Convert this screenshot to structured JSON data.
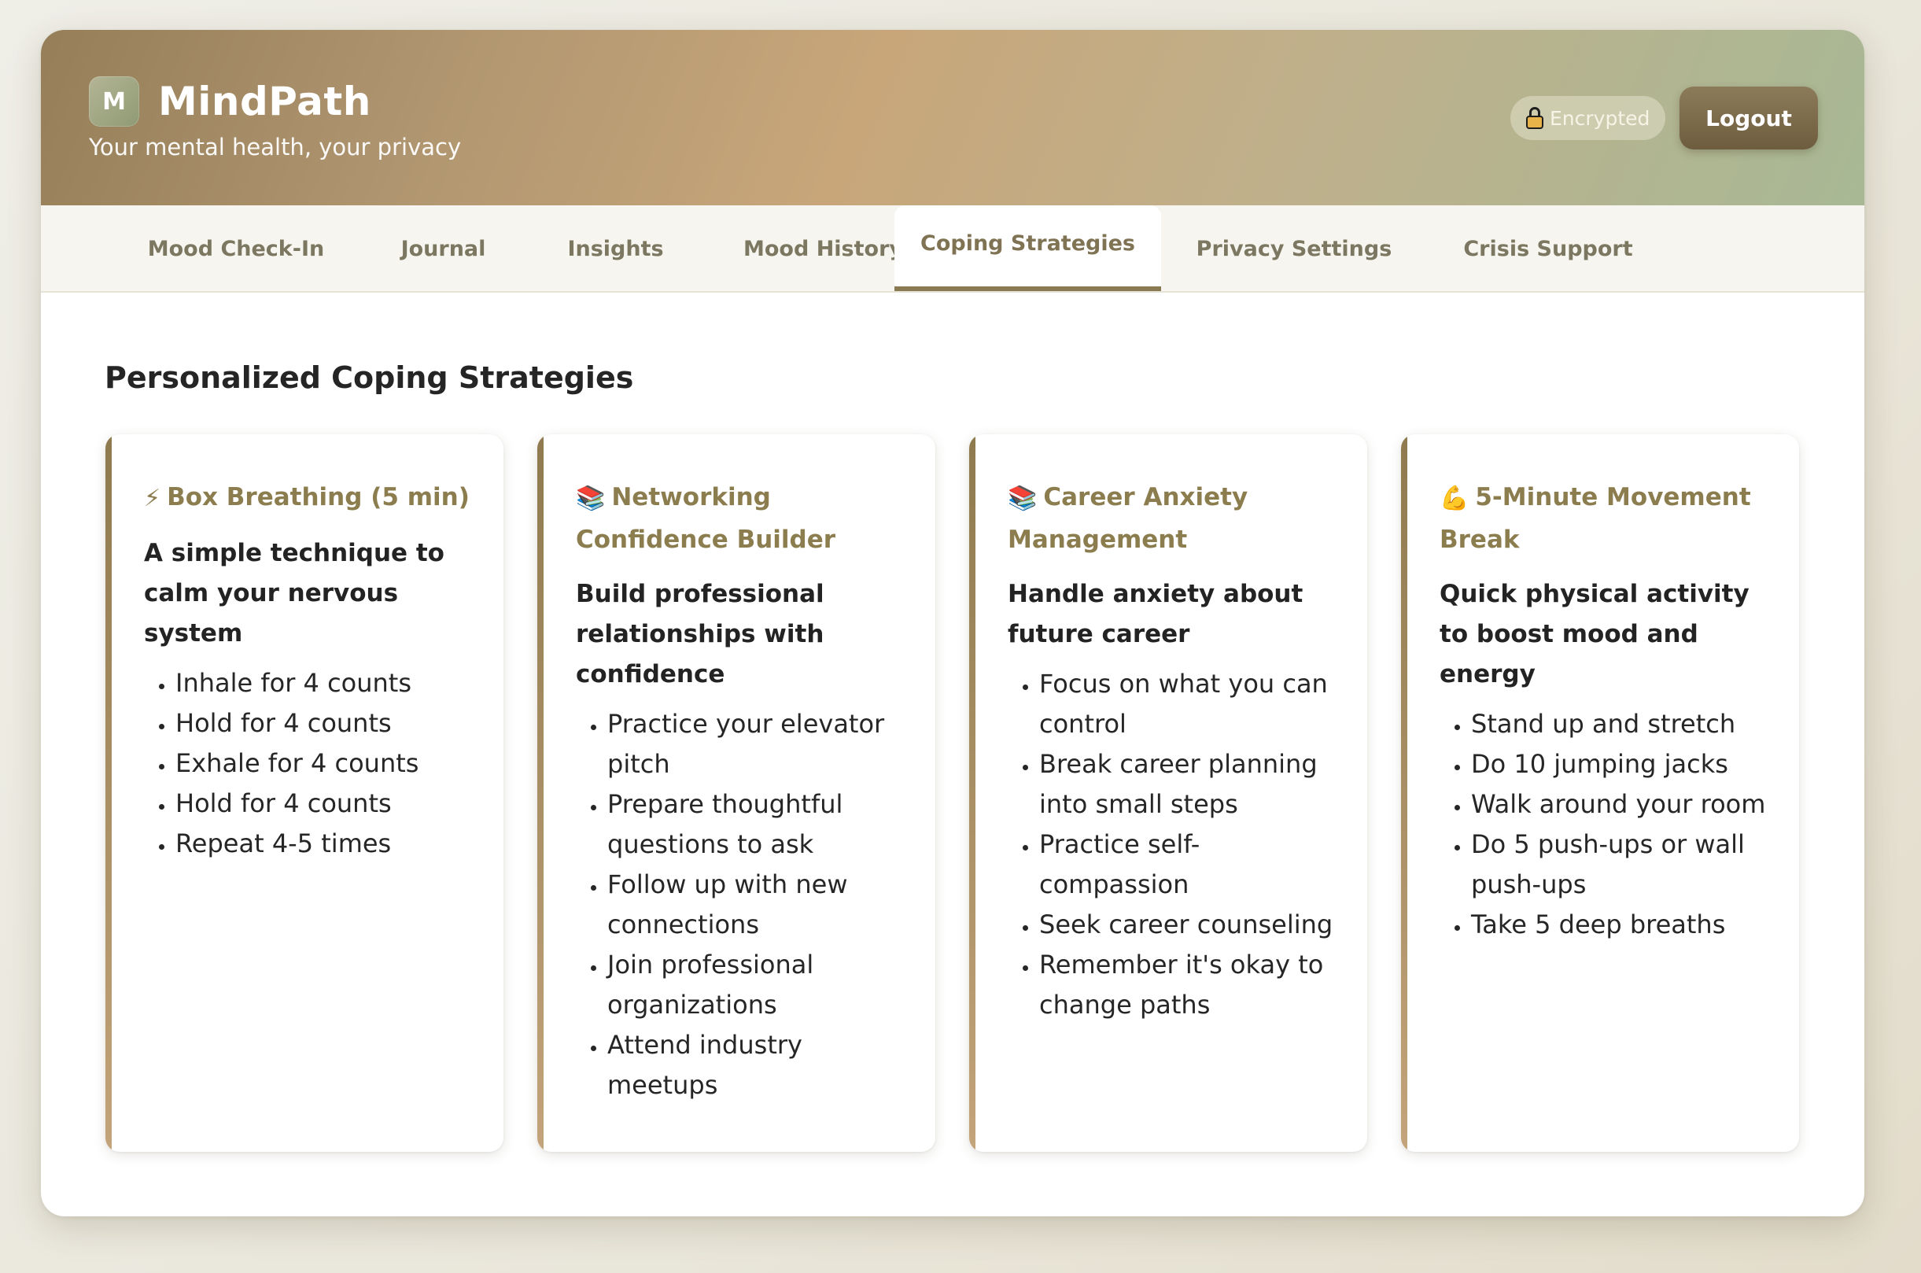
{
  "app": {
    "logo_letter": "M",
    "name": "MindPath",
    "tagline": "Your mental health, your privacy",
    "encrypted_label": "Encrypted",
    "logout_label": "Logout"
  },
  "tabs": [
    {
      "label": "Mood Check-In",
      "active": false
    },
    {
      "label": "Journal",
      "active": false
    },
    {
      "label": "Insights",
      "active": false
    },
    {
      "label": "Mood History",
      "active": false
    },
    {
      "label": "Coping Strategies",
      "active": true
    },
    {
      "label": "Privacy Settings",
      "active": false
    },
    {
      "label": "Crisis Support",
      "active": false
    }
  ],
  "main": {
    "section_title": "Personalized Coping Strategies",
    "strategies": [
      {
        "icon": "⚡",
        "icon_name": "lightning-icon",
        "title": "Box Breathing (5 min)",
        "subtitle": "A simple technique to calm your nervous system",
        "steps": [
          "Inhale for 4 counts",
          "Hold for 4 counts",
          "Exhale for 4 counts",
          "Hold for 4 counts",
          "Repeat 4-5 times"
        ]
      },
      {
        "icon": "📚",
        "icon_name": "books-icon",
        "title": "Networking Confidence Builder",
        "subtitle": "Build professional relationships with confidence",
        "steps": [
          "Practice your elevator pitch",
          "Prepare thoughtful questions to ask",
          "Follow up with new connections",
          "Join professional organizations",
          "Attend industry meetups"
        ]
      },
      {
        "icon": "📚",
        "icon_name": "books-icon",
        "title": "Career Anxiety Management",
        "subtitle": "Handle anxiety about future career",
        "steps": [
          "Focus on what you can control",
          "Break career planning into small steps",
          "Practice self-compassion",
          "Seek career counseling",
          "Remember it's okay to change paths"
        ]
      },
      {
        "icon": "💪",
        "icon_name": "flexed-biceps-icon",
        "title": "5-Minute Movement Break",
        "subtitle": "Quick physical activity to boost mood and energy",
        "steps": [
          "Stand up and stretch",
          "Do 10 jumping jacks",
          "Walk around your room",
          "Do 5 push-ups or wall push-ups",
          "Take 5 deep breaths"
        ]
      }
    ]
  },
  "colors": {
    "accent": "#8a7a52",
    "card_title": "#8c7d4f",
    "tab_text": "#7c7761"
  }
}
